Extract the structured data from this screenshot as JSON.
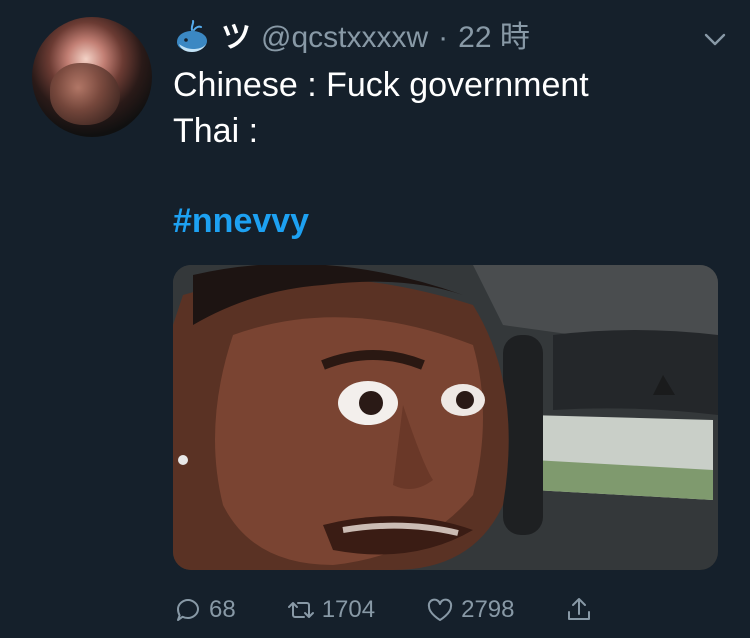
{
  "tweet": {
    "display_name": "ツ",
    "handle": "@qcstxxxxw",
    "separator": "·",
    "time": "22 時",
    "text": "Chinese : Fuck government\nThai :",
    "hashtag": "#nnevvy",
    "counts": {
      "replies": "68",
      "retweets": "1704",
      "likes": "2798"
    }
  },
  "icons": {
    "name_emoji": "whale-icon",
    "menu": "chevron-down-icon",
    "reply": "reply-icon",
    "retweet": "retweet-icon",
    "like": "heart-icon",
    "share": "share-icon"
  },
  "colors": {
    "background": "#15202b",
    "text": "#ffffff",
    "muted": "#8899a6",
    "link": "#1da1f2"
  }
}
